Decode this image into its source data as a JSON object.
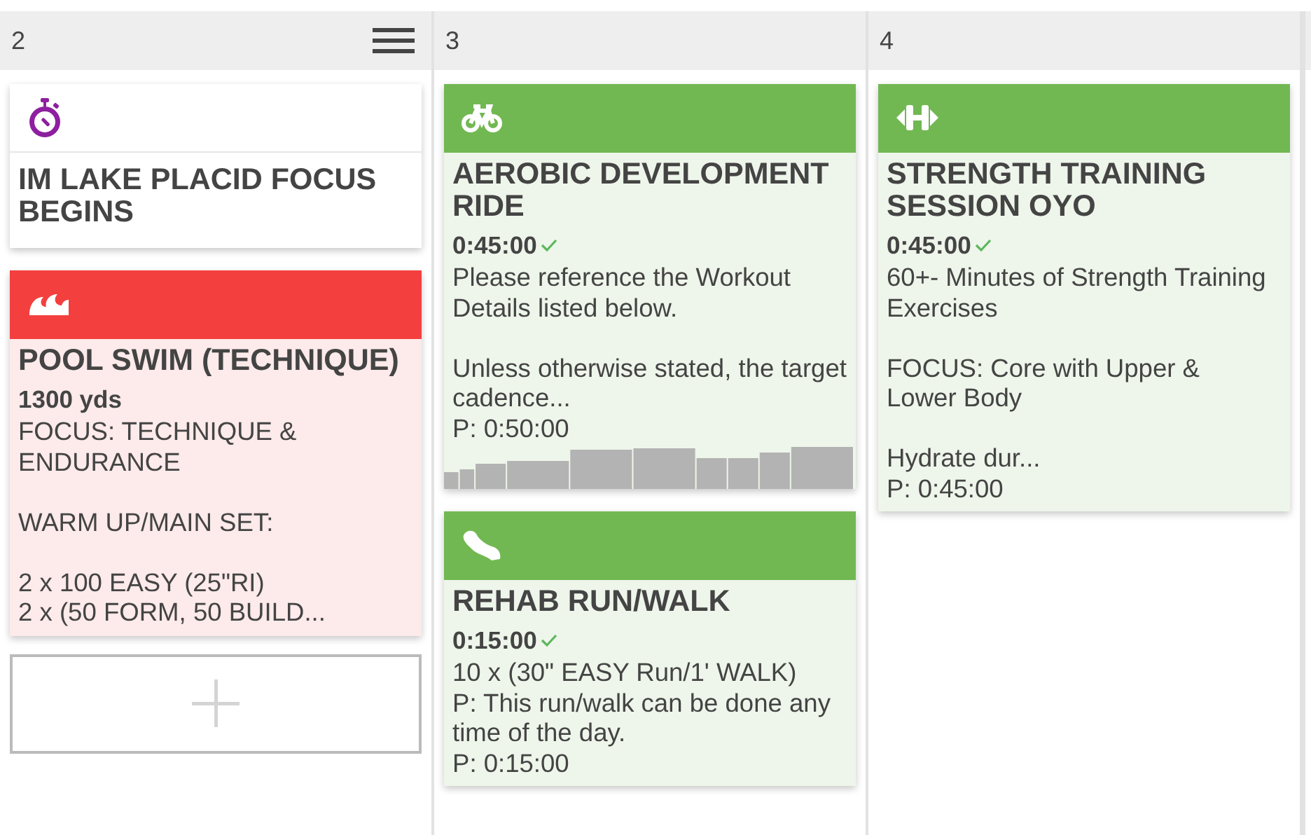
{
  "days": [
    {
      "label": "2",
      "menu": true,
      "add_slot": true,
      "cards": [
        {
          "kind": "note",
          "missed": false,
          "completed": false,
          "title": "IM LAKE PLACID FOCUS BEGINS"
        },
        {
          "kind": "swim",
          "missed": true,
          "completed": false,
          "title": "POOL SWIM (TECHNIQUE)",
          "duration": "1300 yds",
          "description": "FOCUS: TECHNIQUE &\nENDURANCE\n\nWARM UP/MAIN SET:\n\n2 x 100 EASY (25\"RI)\n2 x (50 FORM, 50 BUILD..."
        }
      ]
    },
    {
      "label": "3",
      "menu": false,
      "add_slot": false,
      "cards": [
        {
          "kind": "bike",
          "missed": false,
          "completed": true,
          "title": "AEROBIC DEVELOPMENT RIDE",
          "duration": "0:45:00",
          "description": "Please reference the Workout Details listed below.\n\nUnless otherwise stated, the target cadence...",
          "planned": "P: 0:50:00",
          "profile": true
        },
        {
          "kind": "run",
          "missed": false,
          "completed": true,
          "title": "REHAB RUN/WALK",
          "duration": "0:15:00",
          "description": "10 x (30\" EASY Run/1' WALK)\nP: This run/walk can be done any time of the day.",
          "planned": "P: 0:15:00"
        }
      ]
    },
    {
      "label": "4",
      "menu": false,
      "add_slot": false,
      "cards": [
        {
          "kind": "strength",
          "missed": false,
          "completed": true,
          "title": "STRENGTH TRAINING SESSION OYO",
          "duration": "0:45:00",
          "description": "60+- Minutes of Strength Training Exercises\n\nFOCUS: Core with Upper &\nLower Body\n\nHydrate dur...",
          "planned": "P: 0:45:00"
        }
      ]
    }
  ]
}
